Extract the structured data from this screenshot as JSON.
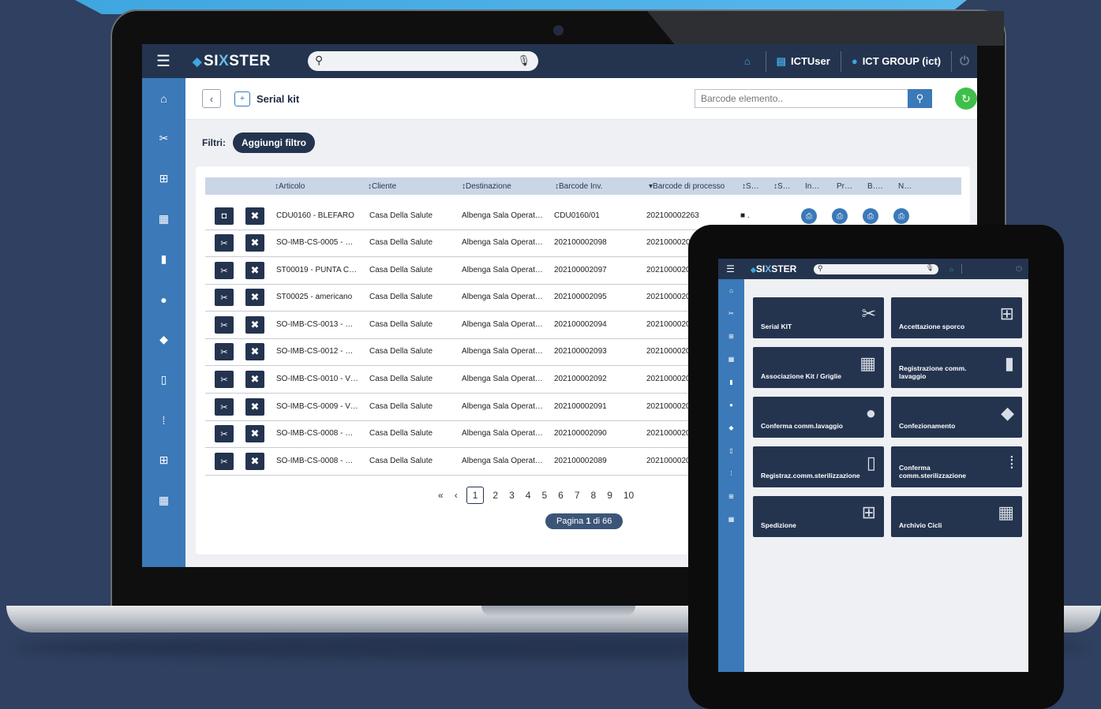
{
  "app": {
    "brand_prefix": "SI",
    "brand_x": "X",
    "brand_suffix": "STER"
  },
  "topbar": {
    "user": "ICTUser",
    "group": "ICT GROUP (ict)",
    "search_placeholder": ""
  },
  "page": {
    "title": "Serial kit",
    "barcode_placeholder": "Barcode elemento.."
  },
  "filters": {
    "label": "Filtri:",
    "add": "Aggiungi filtro"
  },
  "table": {
    "headers": [
      "↕Articolo",
      "↕Cliente",
      "↕Destinazione",
      "↕Barcode Inv.",
      "▾Barcode di processo",
      "↕S…",
      "↕S…",
      "In…",
      "Pr…",
      "B….",
      "N…"
    ],
    "rows": [
      {
        "articolo": "CDU0160 - BLEFARO",
        "cliente": "Casa Della Salute",
        "destinazione": "Albenga Sala Operat…",
        "barcode_inv": "CDU0160/01",
        "barcode_proc": "202100002263",
        "status": "■ ."
      },
      {
        "articolo": "SO-IMB-CS-0005 - …",
        "cliente": "Casa Della Salute",
        "destinazione": "Albenga Sala Operat…",
        "barcode_inv": "202100002098",
        "barcode_proc": "20210000202"
      },
      {
        "articolo": "ST00019 - PUNTA C…",
        "cliente": "Casa Della Salute",
        "destinazione": "Albenga Sala Operat…",
        "barcode_inv": "202100002097",
        "barcode_proc": "20210000202"
      },
      {
        "articolo": "ST00025 - americano",
        "cliente": "Casa Della Salute",
        "destinazione": "Albenga Sala Operat…",
        "barcode_inv": "202100002095",
        "barcode_proc": "20210000202"
      },
      {
        "articolo": "SO-IMB-CS-0013 - …",
        "cliente": "Casa Della Salute",
        "destinazione": "Albenga Sala Operat…",
        "barcode_inv": "202100002094",
        "barcode_proc": "20210000202"
      },
      {
        "articolo": "SO-IMB-CS-0012 - …",
        "cliente": "Casa Della Salute",
        "destinazione": "Albenga Sala Operat…",
        "barcode_inv": "202100002093",
        "barcode_proc": "20210000202"
      },
      {
        "articolo": "SO-IMB-CS-0010 - V…",
        "cliente": "Casa Della Salute",
        "destinazione": "Albenga Sala Operat…",
        "barcode_inv": "202100002092",
        "barcode_proc": "20210000202"
      },
      {
        "articolo": "SO-IMB-CS-0009 - V…",
        "cliente": "Casa Della Salute",
        "destinazione": "Albenga Sala Operat…",
        "barcode_inv": "202100002091",
        "barcode_proc": "20210000202"
      },
      {
        "articolo": "SO-IMB-CS-0008 - …",
        "cliente": "Casa Della Salute",
        "destinazione": "Albenga Sala Operat…",
        "barcode_inv": "202100002090",
        "barcode_proc": "20210000202"
      },
      {
        "articolo": "SO-IMB-CS-0008 - …",
        "cliente": "Casa Della Salute",
        "destinazione": "Albenga Sala Operat…",
        "barcode_inv": "202100002089",
        "barcode_proc": "20210000202"
      }
    ]
  },
  "pager": {
    "first": "«",
    "prev": "‹",
    "pages": [
      "1",
      "2",
      "3",
      "4",
      "5",
      "6",
      "7",
      "8",
      "9",
      "10"
    ],
    "info_prefix": "Pagina",
    "info_current": "1",
    "info_suffix": "di 66"
  },
  "tablet_tiles": [
    {
      "label": "Serial KIT",
      "icon": "scissors-icon"
    },
    {
      "label": "Accettazione sporco",
      "icon": "arrow-grid-icon"
    },
    {
      "label": "Associazione Kit / Griglie",
      "icon": "kit-grid-icon"
    },
    {
      "label": "Registrazione comm. lavaggio",
      "icon": "washer-icon"
    },
    {
      "label": "Conferma comm.lavaggio",
      "icon": "drop-check-icon"
    },
    {
      "label": "Confezionamento",
      "icon": "box-icon"
    },
    {
      "label": "Registraz.comm.sterilizzazione",
      "icon": "sterilizer-icon"
    },
    {
      "label": "Conferma comm.sterilizzazione",
      "icon": "dots-check-icon"
    },
    {
      "label": "Spedizione",
      "icon": "grid-arrow-icon"
    },
    {
      "label": "Archivio Cicli",
      "icon": "archive-icon"
    }
  ],
  "colors": {
    "navy": "#24344f",
    "blue": "#3b79b8",
    "green": "#3fbf4a",
    "background": "#2f4060"
  }
}
